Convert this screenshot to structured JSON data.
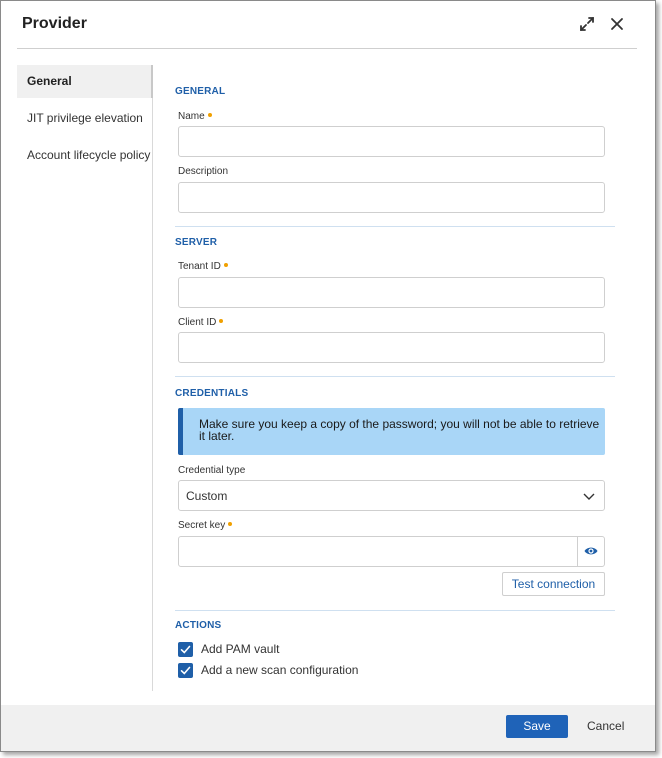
{
  "dialog": {
    "title": "Provider",
    "expand_icon": "expand-icon",
    "close_icon": "close-icon"
  },
  "sidebar": {
    "items": [
      {
        "label": "General",
        "active": true
      },
      {
        "label": "JIT privilege elevation",
        "active": false
      },
      {
        "label": "Account lifecycle policy",
        "active": false
      }
    ]
  },
  "sections": {
    "general": {
      "title": "GENERAL",
      "name_label": "Name",
      "name_value": "",
      "description_label": "Description",
      "description_value": ""
    },
    "server": {
      "title": "SERVER",
      "tenant_label": "Tenant ID",
      "tenant_value": "",
      "client_label": "Client ID",
      "client_value": ""
    },
    "credentials": {
      "title": "CREDENTIALS",
      "banner_text": "Make sure you keep a copy of the password; you will not be able to retrieve it later.",
      "credential_type_label": "Credential type",
      "credential_type_value": "Custom",
      "secret_key_label": "Secret key",
      "secret_key_value": "",
      "test_connection_label": "Test connection"
    },
    "actions": {
      "title": "ACTIONS",
      "checkboxes": [
        {
          "label": "Add PAM vault",
          "checked": true
        },
        {
          "label": "Add a new scan configuration",
          "checked": true
        }
      ]
    }
  },
  "footer": {
    "save_label": "Save",
    "cancel_label": "Cancel"
  },
  "colors": {
    "accent": "#1f5fa8",
    "banner_bg": "#a9d6f7",
    "required_dot": "#f0a000",
    "save_bg": "#1f63b8"
  }
}
